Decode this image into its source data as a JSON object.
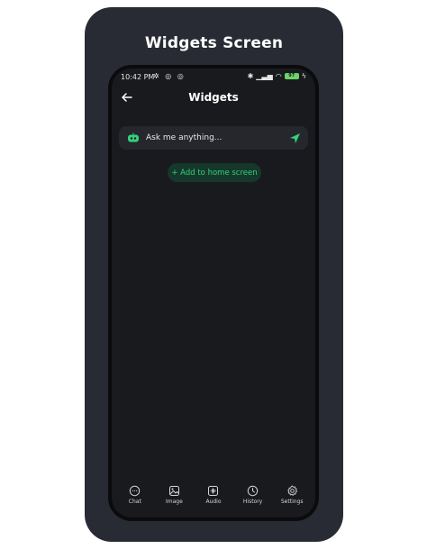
{
  "card": {
    "title": "Widgets Screen"
  },
  "status_bar": {
    "time": "10:42 PM",
    "battery": "97"
  },
  "app_bar": {
    "title": "Widgets"
  },
  "ask": {
    "placeholder": "Ask me anything..."
  },
  "add_button": {
    "label": "+ Add to home screen"
  },
  "nav": {
    "items": [
      {
        "label": "Chat",
        "icon": "chat-icon"
      },
      {
        "label": "Image",
        "icon": "image-icon"
      },
      {
        "label": "Audio",
        "icon": "audio-icon"
      },
      {
        "label": "History",
        "icon": "history-icon"
      },
      {
        "label": "Settings",
        "icon": "gear-icon"
      }
    ]
  },
  "colors": {
    "background": "#ffffff",
    "card": "#282b33",
    "screen": "#191a1d",
    "accent_green": "#33d17a",
    "button_bg": "#16382b"
  }
}
